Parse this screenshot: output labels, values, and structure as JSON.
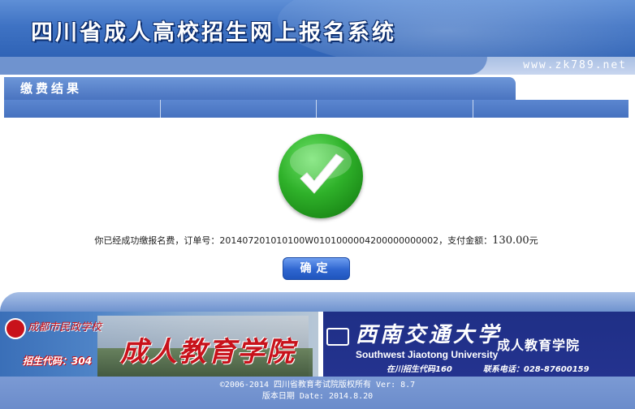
{
  "header": {
    "title": "四川省成人高校招生网上报名系统",
    "url": "www.zk789.net"
  },
  "section": {
    "title": "缴费结果"
  },
  "result": {
    "icon": "check-icon",
    "message_prefix": "你已经成功缴报名费，订单号：201407201010100W0101000004200000000002，支付金额：",
    "amount": "130.00",
    "currency": "元",
    "confirm_label": "确定"
  },
  "banner_left": {
    "school_name": "成都市民政学校",
    "code": "招生代码：304",
    "college": "成人教育学院"
  },
  "banner_right": {
    "university_cn": "西南交通大学",
    "college": "成人教育学院",
    "university_en": "Southwest Jiaotong University",
    "code": "在川招生代码160",
    "phone": "联系电话：028-87600159"
  },
  "footer": {
    "copyright": "©2006-2014 四川省教育考试院版权所有  Ver: 8.7",
    "version_date": "版本日期 Date: 2014.8.20"
  },
  "colors": {
    "header_blue": "#3f73c4",
    "success_green": "#2fb12a",
    "button_blue": "#2f66d0",
    "brand_red": "#c8121b"
  }
}
